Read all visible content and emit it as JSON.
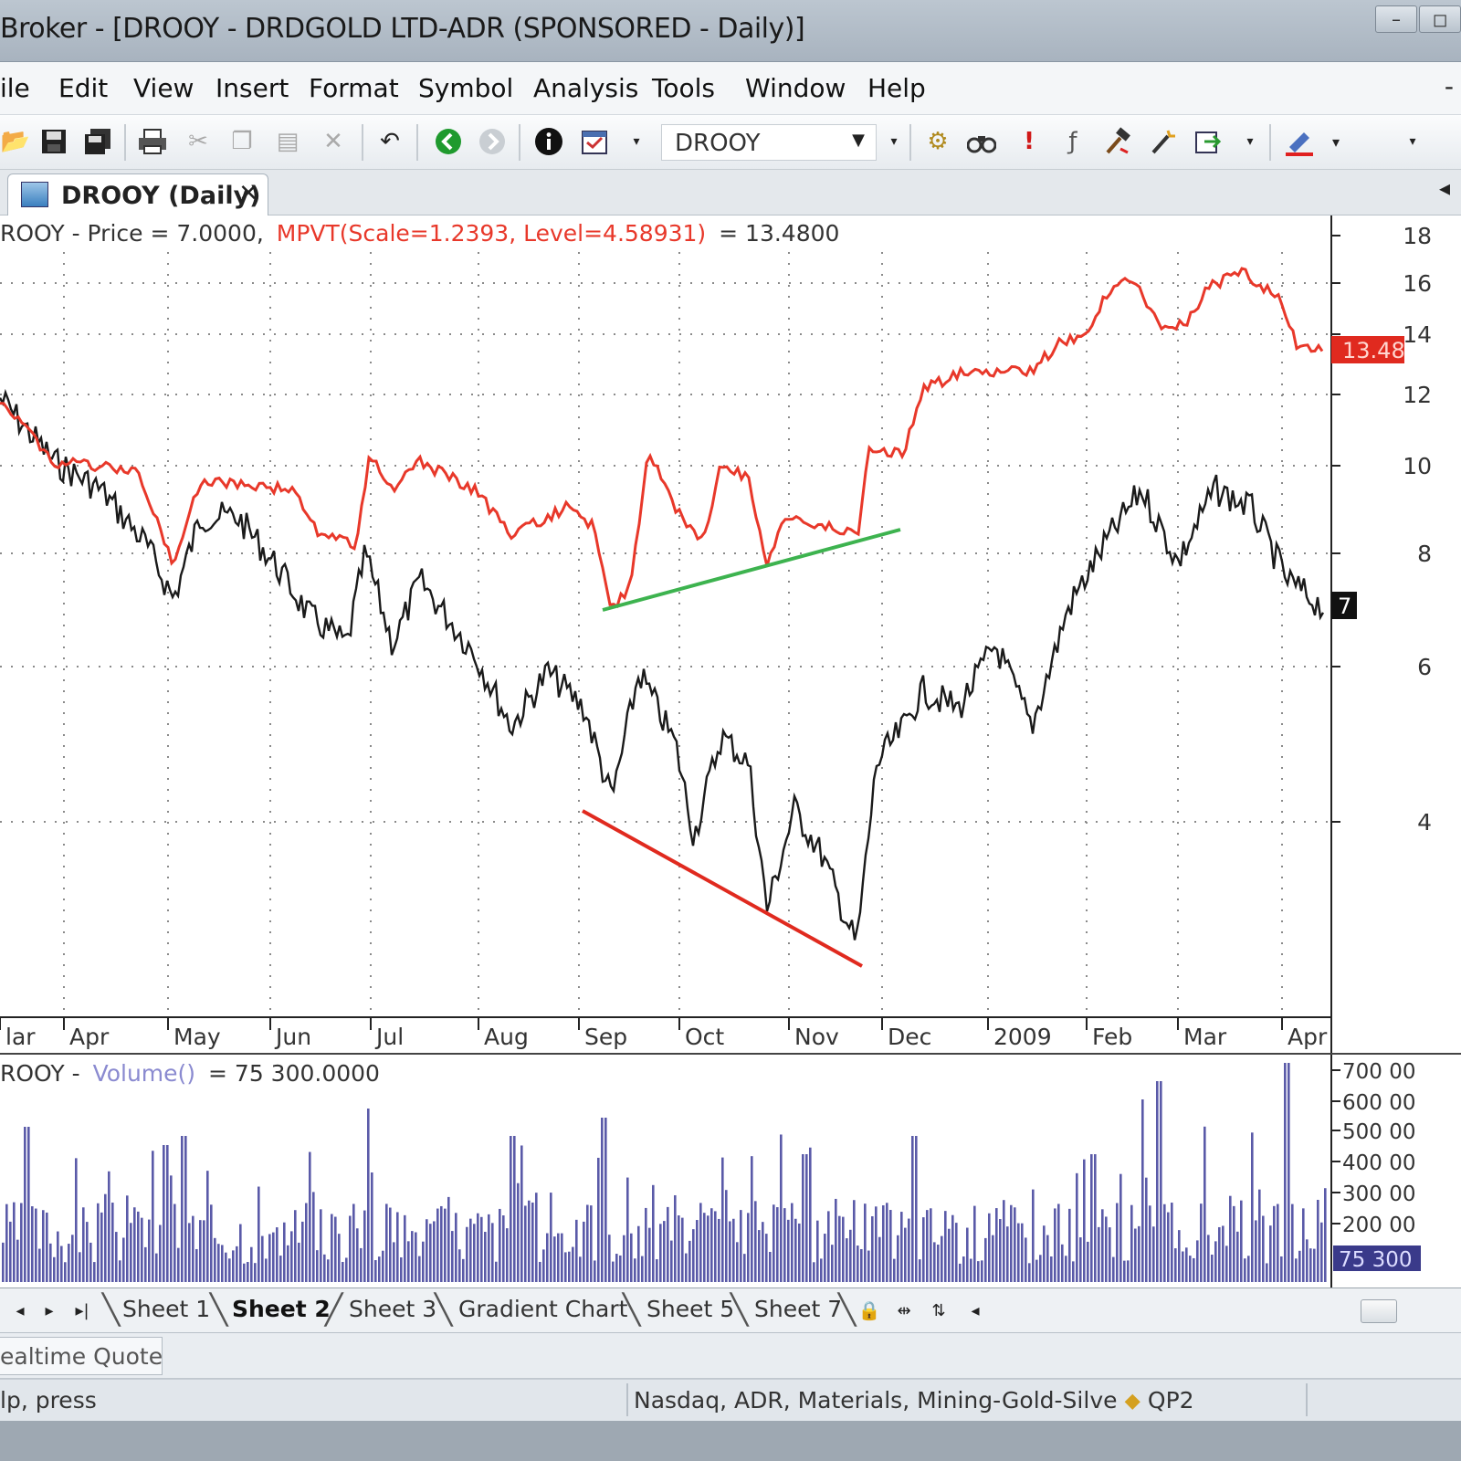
{
  "window": {
    "title": "Broker - [DROOY - DRDGOLD LTD-ADR (SPONSORED - Daily)]",
    "controls": [
      "–",
      "◻"
    ]
  },
  "menu": [
    "ile",
    "Edit",
    "View",
    "Insert",
    "Format",
    "Symbol",
    "Analysis",
    "Tools",
    "Window",
    "Help"
  ],
  "menu_close": "-",
  "toolbar": {
    "symbol": "DROOY",
    "icons": [
      "open-icon",
      "save-icon",
      "save-all-icon",
      "print-icon",
      "cut-icon",
      "copy-icon",
      "paste-icon",
      "delete-icon",
      "undo-icon",
      "go-forward-icon",
      "go-back-icon",
      "info-icon",
      "calendar-icon",
      "settings-icon",
      "binoculars-icon",
      "alert-icon",
      "formula-icon",
      "hammer-icon",
      "wand-icon",
      "export-icon",
      "pen-icon"
    ]
  },
  "chart_tab": {
    "label": "DROOY (Daily)",
    "close": "✕",
    "scroll": "◂"
  },
  "price_pane": {
    "legend_prefix": "ROOY - Price = 7.0000,",
    "legend_indicator": "MPVT(Scale=1.2393, Level=4.58931)",
    "legend_value": "= 13.4800",
    "axis_labels": [
      "18",
      "16",
      "14",
      "12",
      "10",
      "8",
      "6",
      "4"
    ],
    "mpvt_tag": "13.48",
    "price_tag": "7",
    "month_labels": [
      "lar",
      "Apr",
      "May",
      "Jun",
      "Jul",
      "Aug",
      "Sep",
      "Oct",
      "Nov",
      "Dec",
      "2009",
      "Feb",
      "Mar",
      "Apr"
    ],
    "colors": {
      "price": "#1a1a1a",
      "mpvt": "#e8382a",
      "support": "#3db34f",
      "resistance": "#e02a1f",
      "grid": "#9a9a9a"
    }
  },
  "volume_pane": {
    "legend_prefix": "ROOY -",
    "legend_indicator": "Volume()",
    "legend_value": "= 75 300.0000",
    "axis_labels": [
      "700 00",
      "600 00",
      "500 00",
      "400 00",
      "300 00",
      "200 00"
    ],
    "tag": "75 300",
    "color": "#5a5aa8"
  },
  "chart_data": [
    {
      "type": "line",
      "title": "",
      "xlabel": "",
      "ylabel": "",
      "x": [
        "Mar",
        "Apr",
        "May",
        "Jun",
        "Jul",
        "Aug",
        "Sep",
        "Oct",
        "Nov",
        "Dec",
        "2009",
        "Feb",
        "Mar",
        "Apr"
      ],
      "ylim": [
        3.2,
        18.5
      ],
      "y_scale": "log",
      "series": [
        {
          "name": "Price",
          "values": [
            12.0,
            10.0,
            7.3,
            8.8,
            7.2,
            7.5,
            5.2,
            4.0,
            5.0,
            3.5,
            5.7,
            6.0,
            9.5,
            9.8,
            7.0
          ]
        },
        {
          "name": "MPVT(Scale=1.2393, Level=4.58931)",
          "values": [
            12.0,
            10.2,
            8.0,
            9.6,
            9.0,
            10.3,
            9.2,
            8.8,
            9.0,
            7.0,
            10.5,
            8.5,
            12.5,
            12.8,
            16.2,
            16.4,
            13.48
          ]
        }
      ]
    },
    {
      "type": "bar",
      "title": "",
      "series": [
        {
          "name": "Volume()",
          "last": 75300
        }
      ],
      "ylim": [
        0,
        700000
      ]
    }
  ],
  "sheets": {
    "tabs": [
      "Sheet 1",
      "Sheet 2",
      "Sheet 3",
      "Gradient Chart",
      "Sheet 5",
      "Sheet 7"
    ],
    "active": "Sheet 2",
    "nav": [
      "◂",
      "▸",
      "▸|"
    ]
  },
  "quote_tab": "ealtime Quote",
  "status": {
    "help": "lp, press",
    "info": "Nasdaq, ADR, Materials, Mining-Gold-Silve",
    "server": "QP2"
  }
}
